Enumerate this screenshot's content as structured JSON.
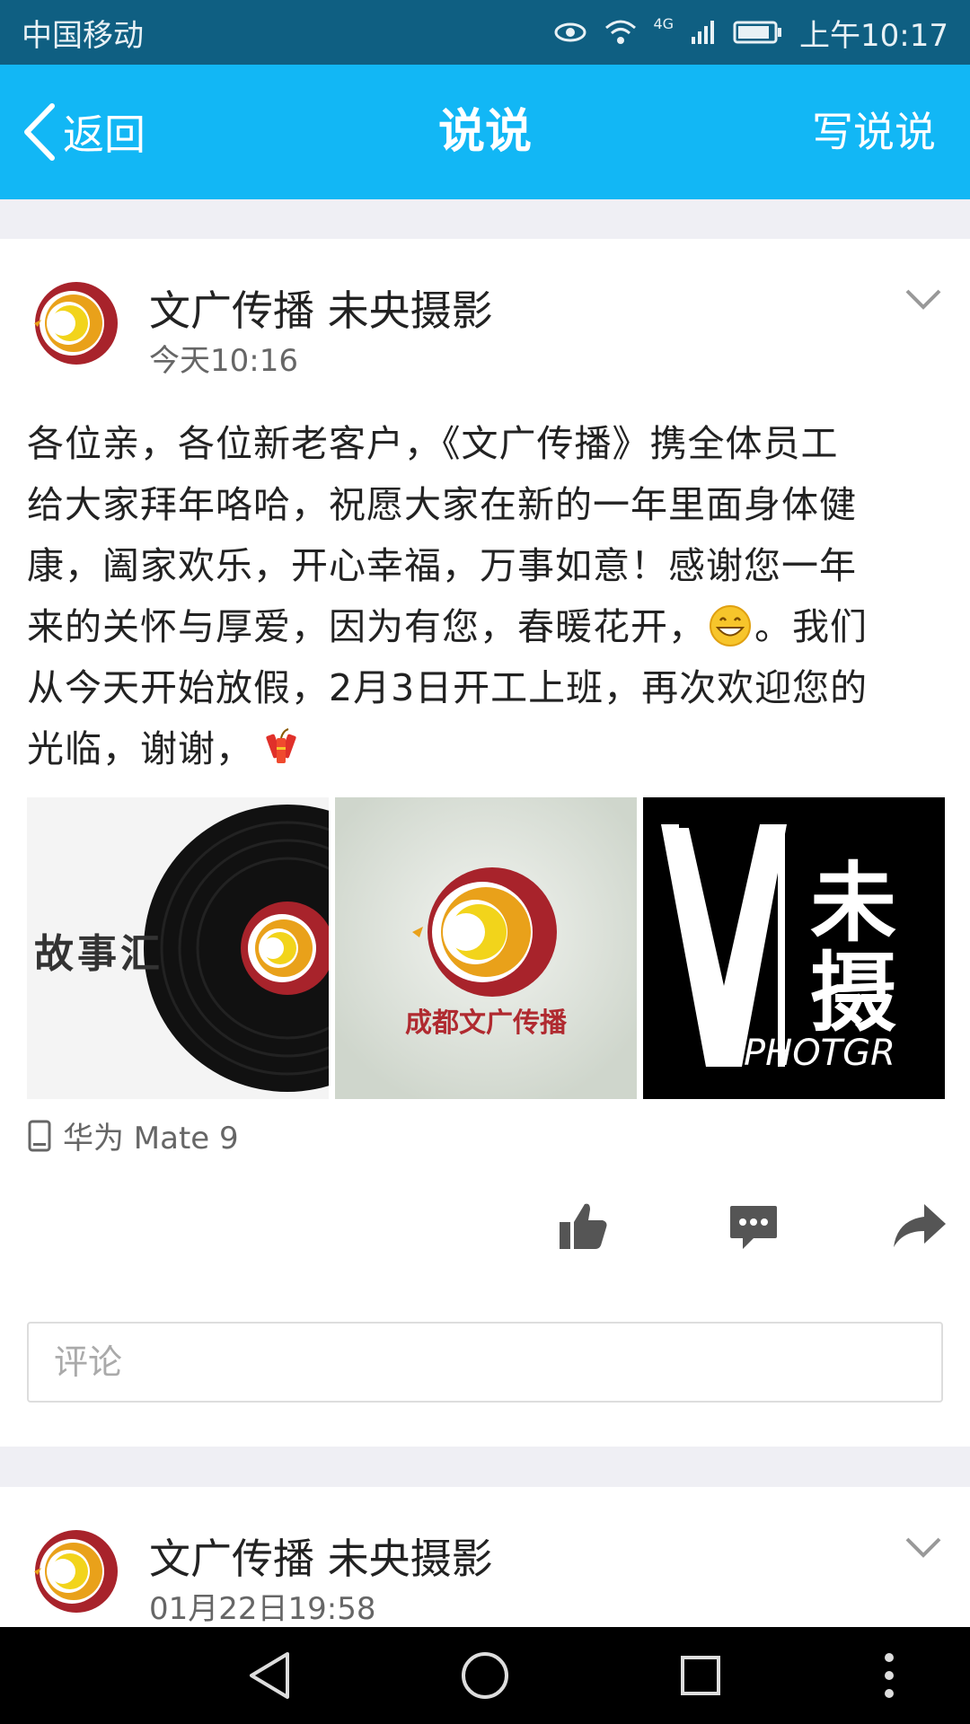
{
  "status_bar": {
    "carrier": "中国移动",
    "network": "4G",
    "time": "上午10:17"
  },
  "header": {
    "back_label": "返回",
    "title": "说说",
    "write_label": "写说说"
  },
  "post": {
    "author": "文广传播 未央摄影",
    "time": "今天10:16",
    "content_lines": [
      "各位亲，各位新老客户，《文广传播》携全体员工",
      "给大家拜年咯哈，祝愿大家在新的一年里面身体健",
      "康，阖家欢乐，开心幸福，万事如意！感谢您一年",
      "来的关怀与厚爱，因为有您，春暖花开，",
      "。我们",
      "从今天开始放假，2月3日开工上班，再次欢迎您的",
      "光临，谢谢，"
    ],
    "photos": {
      "photo1_text": "故事汇",
      "photo2_text": "成都文广传播",
      "photo3_text_top": "未",
      "photo3_text_bottom": "摄",
      "photo3_sub": "PHOTGR"
    },
    "device": "华为 Mate 9",
    "comment_placeholder": "评论"
  },
  "next_post": {
    "author": "文广传播 未央摄影",
    "time": "01月22日19:58"
  },
  "colors": {
    "status_bar": "#0f5f82",
    "title_bar": "#12b7f5",
    "logo_red": "#a8232b",
    "logo_yellow": "#f2c71b"
  }
}
